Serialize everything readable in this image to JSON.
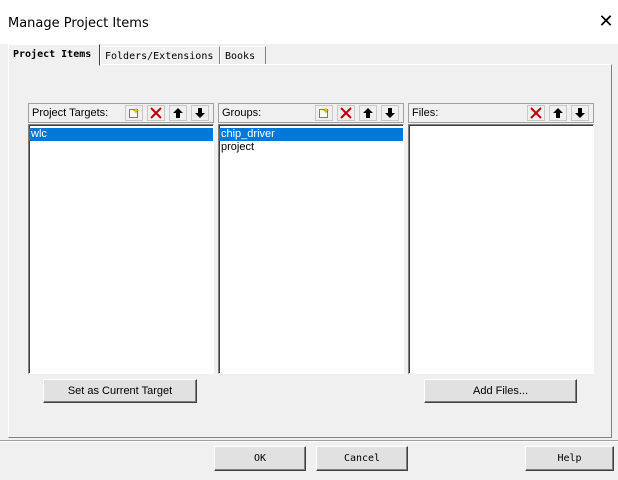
{
  "window": {
    "title": "Manage Project Items",
    "close_glyph": "✕"
  },
  "tabs": [
    {
      "label": "Project Items",
      "active": true
    },
    {
      "label": "Folders/Extensions",
      "active": false
    },
    {
      "label": "Books",
      "active": false
    }
  ],
  "targets_panel": {
    "label": "Project Targets:",
    "items": [
      {
        "text": "wlc",
        "selected": true
      }
    ],
    "button_label": "Set as Current Target"
  },
  "groups_panel": {
    "label": "Groups:",
    "items": [
      {
        "text": "chip_driver",
        "selected": true
      },
      {
        "text": "project",
        "selected": false
      }
    ]
  },
  "files_panel": {
    "label": "Files:",
    "items": [],
    "button_label": "Add Files..."
  },
  "footer": {
    "ok": "OK",
    "cancel": "Cancel",
    "help": "Help"
  },
  "icons": {
    "new": "new-item-icon",
    "delete": "delete-icon",
    "up": "move-up-icon",
    "down": "move-down-icon",
    "delete_color": "#c00000"
  }
}
